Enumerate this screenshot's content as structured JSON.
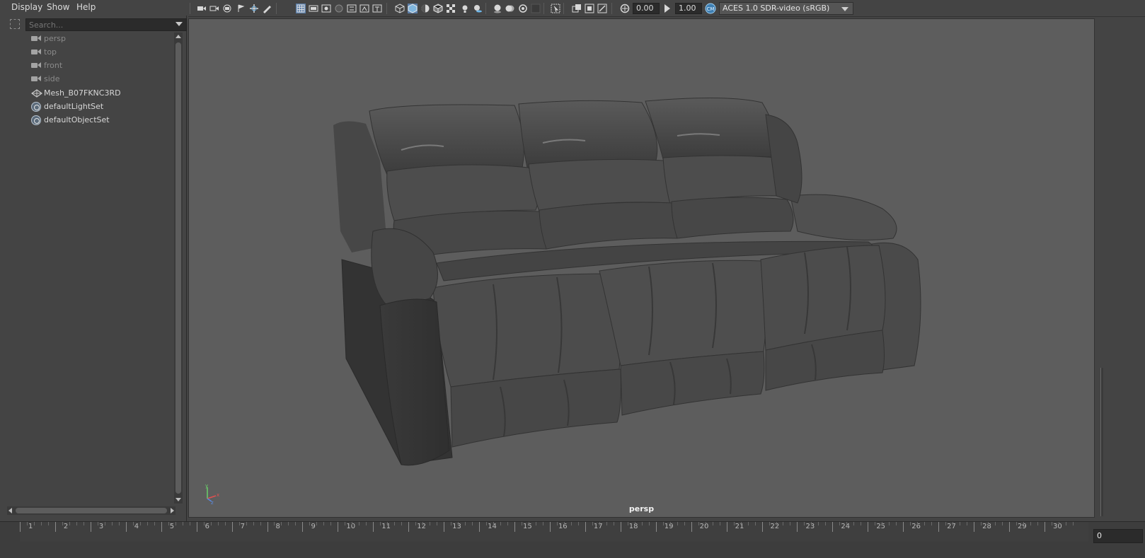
{
  "outliner": {
    "menu": [
      "Display",
      "Show",
      "Help"
    ],
    "search_placeholder": "Search...",
    "items": [
      {
        "label": "persp",
        "icon": "camera-icon",
        "dim": true
      },
      {
        "label": "top",
        "icon": "camera-icon",
        "dim": true
      },
      {
        "label": "front",
        "icon": "camera-icon",
        "dim": true
      },
      {
        "label": "side",
        "icon": "camera-icon",
        "dim": true
      },
      {
        "label": "Mesh_B07FKNC3RD",
        "icon": "mesh-icon",
        "dim": false
      },
      {
        "label": "defaultLightSet",
        "icon": "set-icon",
        "dim": false
      },
      {
        "label": "defaultObjectSet",
        "icon": "set-icon",
        "dim": false
      }
    ]
  },
  "viewport_toolbar": {
    "exposure_value": "0.00",
    "gamma_value": "1.00",
    "color_space": "ACES 1.0 SDR-video (sRGB)"
  },
  "viewport": {
    "camera_name": "persp",
    "background_color": "#5d5d5d",
    "model_color": "#4a4a4a"
  },
  "timeline": {
    "ticks": [
      "1",
      "2",
      "3",
      "4",
      "5",
      "6",
      "7",
      "8",
      "9",
      "10",
      "11",
      "12",
      "13",
      "14",
      "15",
      "16",
      "17",
      "18",
      "19",
      "20",
      "21",
      "22",
      "23",
      "24",
      "25",
      "26",
      "27",
      "28",
      "29",
      "30"
    ],
    "current_frame": "0"
  }
}
